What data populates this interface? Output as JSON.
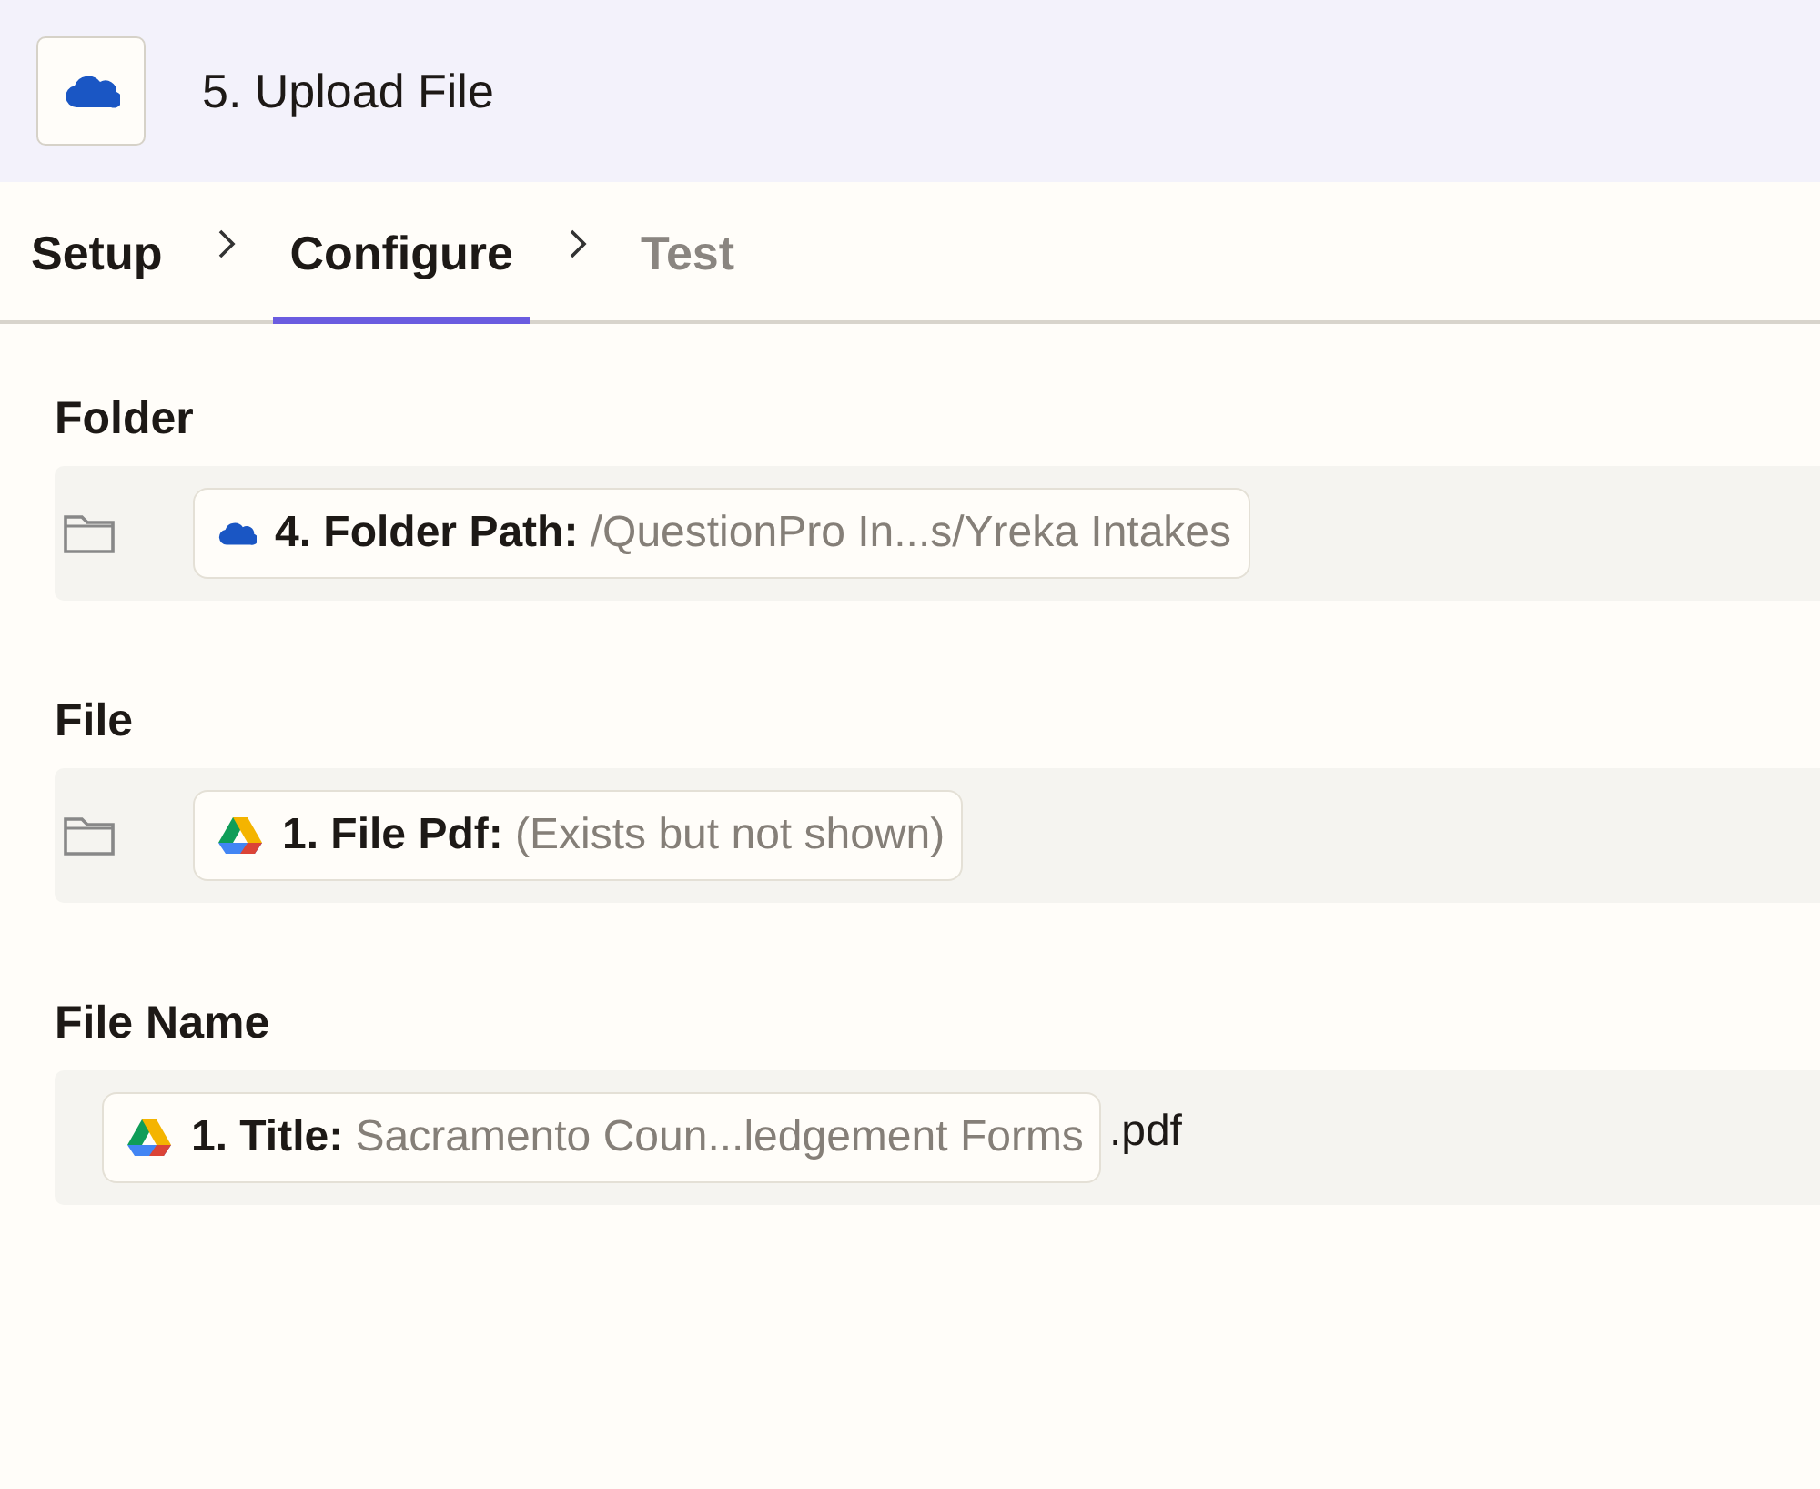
{
  "header": {
    "title": "5. Upload File",
    "kind": "onedrive"
  },
  "tabs": [
    {
      "label": "Setup",
      "selected": false,
      "disabled": false
    },
    {
      "label": "Configure",
      "selected": true,
      "disabled": false
    },
    {
      "label": "Test",
      "selected": false,
      "disabled": true
    }
  ],
  "fields": [
    {
      "label": "Folder",
      "kind": "folder",
      "pill": {
        "kind": "onedrive",
        "step": "4. Folder Path:",
        "value": "/QuestionPro In...s/Yreka Intakes"
      }
    },
    {
      "label": "File",
      "kind": "folder",
      "pill": {
        "kind": "gdrive",
        "step": "1. File Pdf:",
        "value": "(Exists but not shown)"
      }
    },
    {
      "label": "File Name",
      "kind": "text",
      "pill": {
        "kind": "gdrive",
        "step": "1. Title:",
        "value": "Sacramento Coun...ledgement Forms"
      },
      "suffix": ".pdf"
    }
  ]
}
